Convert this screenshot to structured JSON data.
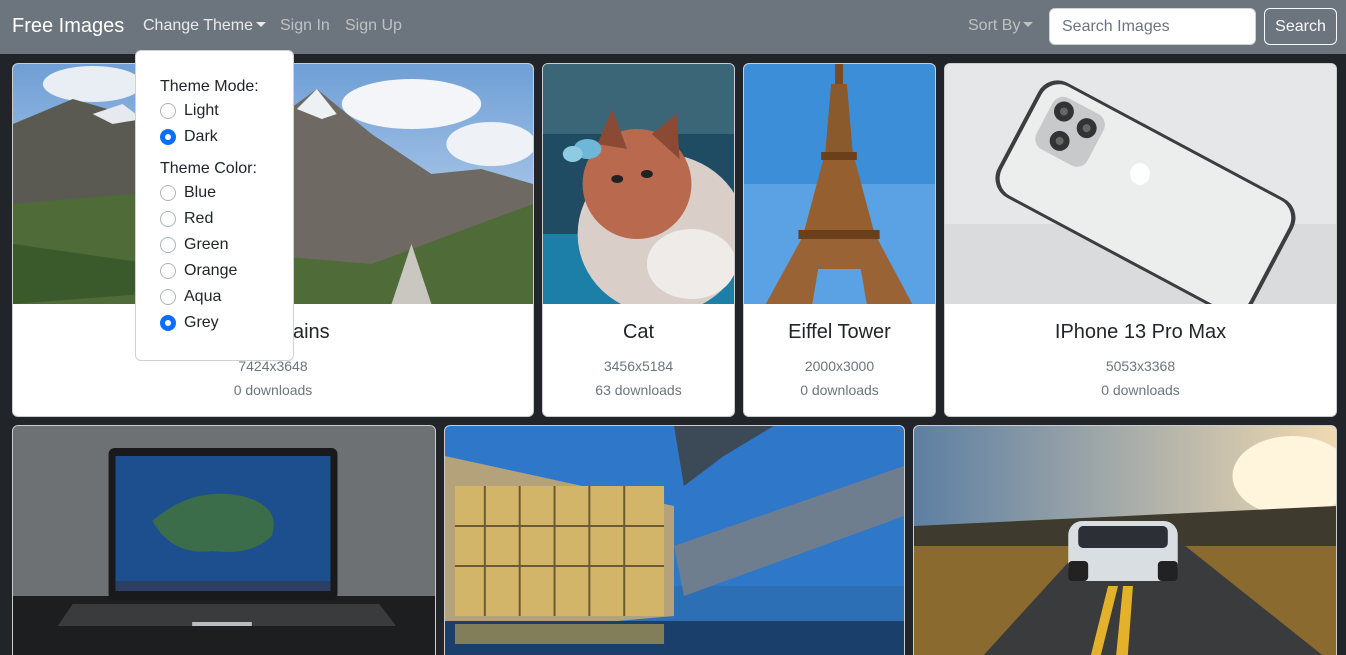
{
  "navbar": {
    "brand": "Free Images",
    "change_theme": "Change Theme",
    "sign_in": "Sign In",
    "sign_up": "Sign Up",
    "sort_by": "Sort By",
    "search_placeholder": "Search Images",
    "search_button": "Search"
  },
  "theme_dropdown": {
    "mode_header": "Theme Mode:",
    "modes": [
      {
        "label": "Light",
        "checked": false
      },
      {
        "label": "Dark",
        "checked": true
      }
    ],
    "color_header": "Theme Color:",
    "colors": [
      {
        "label": "Blue",
        "checked": false
      },
      {
        "label": "Red",
        "checked": false
      },
      {
        "label": "Green",
        "checked": false
      },
      {
        "label": "Orange",
        "checked": false
      },
      {
        "label": "Aqua",
        "checked": false
      },
      {
        "label": "Grey",
        "checked": true
      }
    ]
  },
  "cards": [
    {
      "title": "Mountains",
      "visible_title": "ntains",
      "dimensions": "7424x3648",
      "downloads": "0 downloads"
    },
    {
      "title": "Cat",
      "dimensions": "3456x5184",
      "downloads": "63 downloads"
    },
    {
      "title": "Eiffel Tower",
      "dimensions": "2000x3000",
      "downloads": "0 downloads"
    },
    {
      "title": "IPhone 13 Pro Max",
      "dimensions": "5053x3368",
      "downloads": "0 downloads"
    }
  ],
  "colors": {
    "navbar_bg": "#6c757d",
    "page_bg": "#212529",
    "accent": "#0d6efd"
  }
}
